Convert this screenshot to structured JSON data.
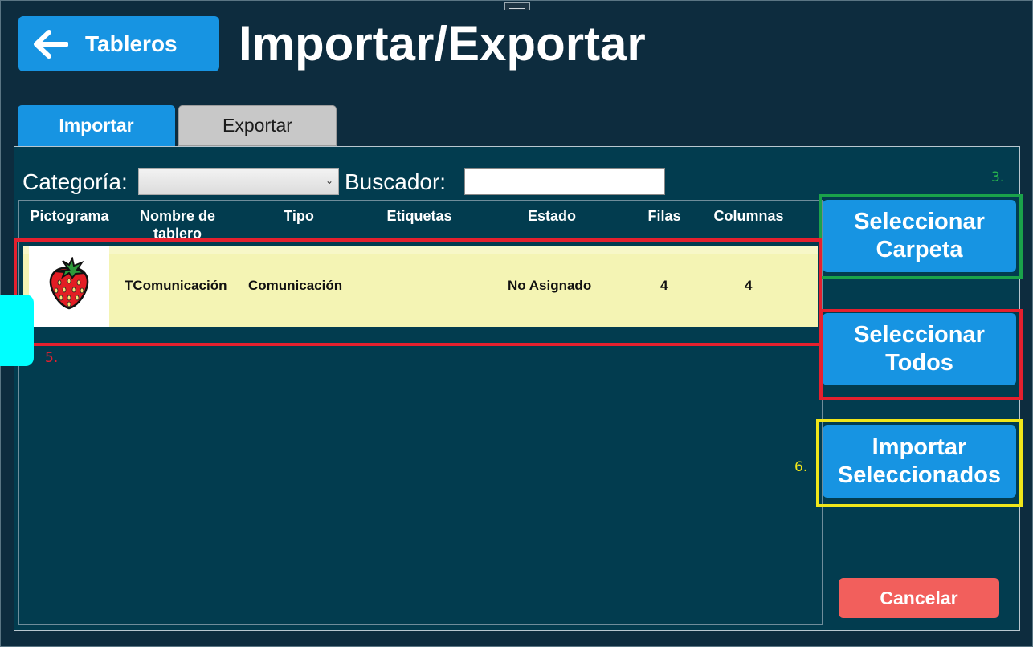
{
  "header": {
    "back_button_label": "Tableros",
    "title": "Importar/Exportar"
  },
  "tabs": [
    {
      "label": "Importar",
      "active": true
    },
    {
      "label": "Exportar",
      "active": false
    }
  ],
  "filters": {
    "category_label": "Categoría:",
    "category_value": "",
    "search_label": "Buscador:",
    "search_value": ""
  },
  "table": {
    "columns": [
      "Pictograma",
      "Nombre de tablero",
      "Tipo",
      "Etiquetas",
      "Estado",
      "Filas",
      "Columnas"
    ],
    "rows": [
      {
        "pictogram": "strawberry-icon",
        "name": "TComunicación",
        "type": "Comunicación",
        "tags": "",
        "status": "No Asignado",
        "rows": "4",
        "columns": "4"
      }
    ]
  },
  "actions": {
    "select_folder": "Seleccionar Carpeta",
    "select_all": "Seleccionar Todos",
    "import_selected": "Importar Seleccionados",
    "cancel": "Cancelar"
  },
  "annotations": {
    "a3": "3.",
    "a5": "5.",
    "a6": "6."
  },
  "colors": {
    "background": "#0d2c3e",
    "panel": "#023c4f",
    "primary_button": "#1794e2",
    "cancel_button": "#f25f5c",
    "row_highlight": "#f4f4b4",
    "annotation_green": "#1aa24a",
    "annotation_red": "#e5202e",
    "annotation_yellow": "#f0e61a"
  }
}
